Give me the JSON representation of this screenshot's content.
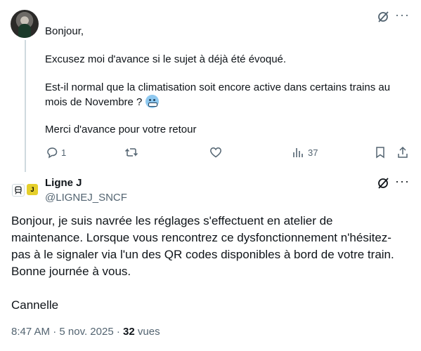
{
  "parent_post": {
    "lines": [
      "Bonjour,",
      "Excusez moi d'avance si le sujet à déjà été évoqué.",
      "Est-il normal que la climatisation soit encore active dans certains trains au",
      "mois de Novembre ?",
      "Merci d'avance pour votre retour"
    ],
    "reply_count": "1",
    "view_count": "37"
  },
  "reply_post": {
    "display_name": "Ligne J",
    "handle": "@LIGNEJ_SNCF",
    "logo_letter": "J",
    "lines": [
      "Bonjour, je suis navrée les réglages s'effectuent en atelier de",
      "maintenance. Lorsque vous rencontrez ce dysfonctionnement n'hésitez-",
      "pas à le signaler via l'un des QR codes disponibles à bord de votre train.",
      "Bonne journée à vous.",
      "Cannelle"
    ],
    "time": "8:47 AM",
    "separator": "·",
    "date": "5 nov. 2025",
    "views_count": "32",
    "views_label": "vues"
  },
  "icons": [
    "grok-icon",
    "more-icon",
    "reply-icon",
    "repost-icon",
    "like-icon",
    "views-icon",
    "bookmark-icon",
    "share-icon",
    "train-icon"
  ],
  "colors": {
    "text": "#0f1419",
    "muted": "#536471",
    "thread_line": "#cfd9de",
    "logo_yellow": "#e5cf2b"
  }
}
